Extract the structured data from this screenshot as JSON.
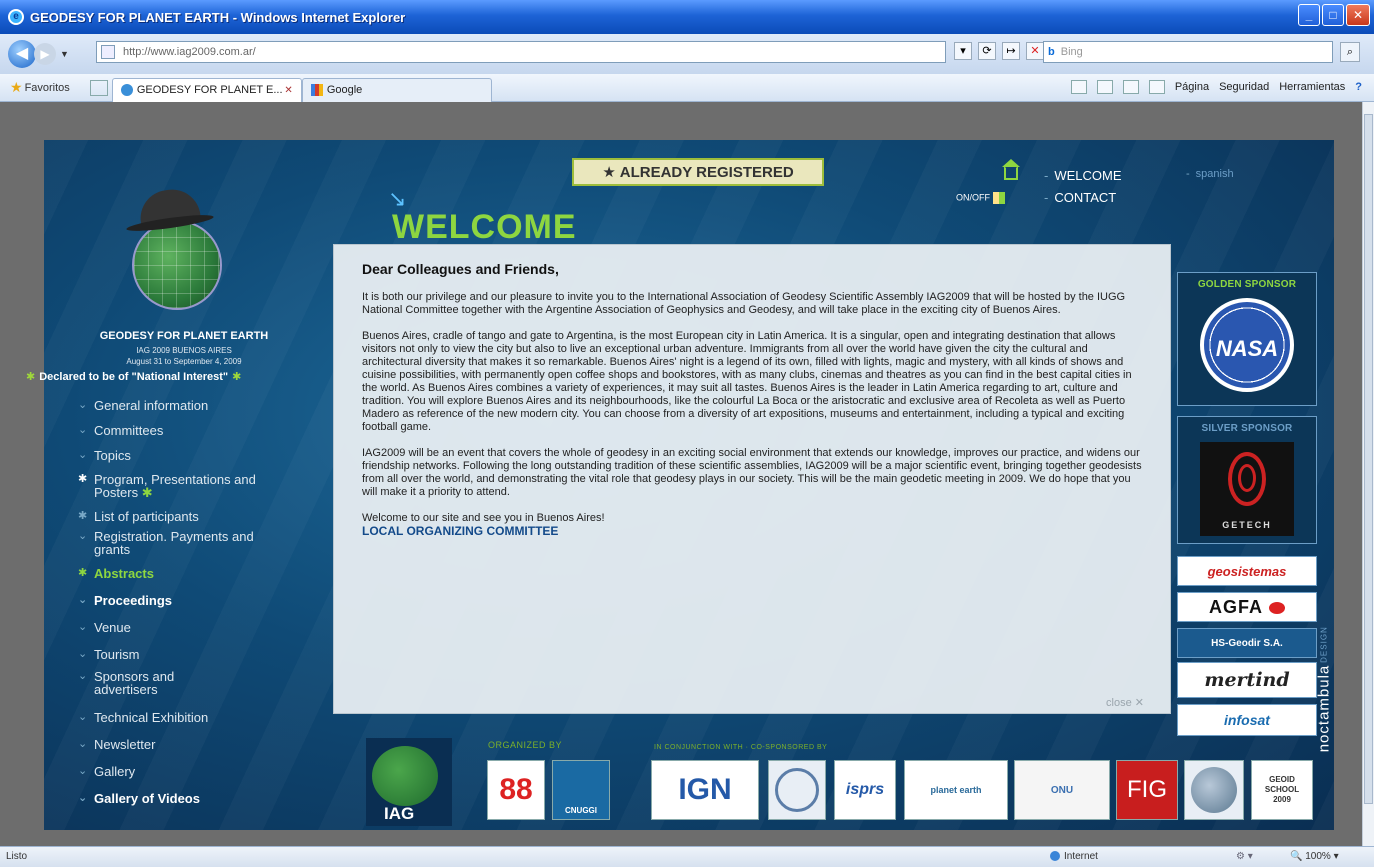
{
  "window": {
    "title": "GEODESY FOR PLANET EARTH - Windows Internet Explorer"
  },
  "address": {
    "url": "http://www.iag2009.com.ar/",
    "search_placeholder": "Bing"
  },
  "favorites": {
    "label": "Favoritos",
    "tabs": [
      {
        "label": "GEODESY FOR PLANET E...",
        "active": true
      },
      {
        "label": "Google",
        "active": false
      }
    ]
  },
  "commands": {
    "page": "Página",
    "security": "Seguridad",
    "tools": "Herramientas"
  },
  "site": {
    "already_registered": "ALREADY REGISTERED",
    "welcome_heading": "WELCOME",
    "top_nav": {
      "welcome": "WELCOME",
      "contact": "CONTACT",
      "onoff": "ON/OFF",
      "language": "spanish"
    },
    "org": {
      "title": "GEODESY FOR PLANET EARTH",
      "subtitle": "IAG 2009 BUENOS AIRES",
      "dates": "August 31 to September 4, 2009",
      "declared": "Declared to be of \"National Interest\""
    },
    "nav": [
      {
        "label": "General information",
        "style": "normal"
      },
      {
        "label": "Committees",
        "style": "normal"
      },
      {
        "label": "Topics",
        "style": "normal"
      },
      {
        "label": "Program, Presentations and Posters",
        "style": "star"
      },
      {
        "label": "List of participants",
        "style": "normal"
      },
      {
        "label": "Registration. Payments and grants",
        "style": "normal"
      },
      {
        "label": "Abstracts",
        "style": "highlight"
      },
      {
        "label": "Proceedings",
        "style": "bold"
      },
      {
        "label": "Venue",
        "style": "normal"
      },
      {
        "label": "Tourism",
        "style": "normal"
      },
      {
        "label": "Sponsors and advertisers",
        "style": "normal"
      },
      {
        "label": "Technical Exhibition",
        "style": "normal"
      },
      {
        "label": "Newsletter",
        "style": "normal"
      },
      {
        "label": "Gallery",
        "style": "normal"
      },
      {
        "label": "Gallery of Videos",
        "style": "bold"
      }
    ],
    "popup": {
      "greeting": "Dear Colleagues and Friends,",
      "p1": "It is both our privilege and our pleasure to invite you to the International Association of Geodesy Scientific Assembly IAG2009 that will be hosted by the IUGG National Committee together with the Argentine Association of Geophysics and Geodesy, and will take place in the exciting city of Buenos Aires.",
      "p2": "Buenos Aires, cradle of tango and gate to Argentina, is the most European city in Latin America. It is a singular, open and integrating destination that allows visitors not only to view the city but also to live an exceptional urban adventure. Immigrants from all over the world have given the city the cultural and architectural diversity that makes it so remarkable. Buenos Aires' night is a legend of its own, filled with lights, magic and mystery, with all kinds of shows and cuisine possibilities, with permanently open coffee shops and bookstores, with as many clubs, cinemas and theatres as you can find in the best capital cities in the world. As Buenos Aires combines a variety of experiences, it may suit all tastes. Buenos Aires is the leader in Latin America regarding to art, culture and tradition. You will explore Buenos Aires and its neighbourhoods, like the colourful La Boca or the aristocratic and exclusive area of Recoleta as well as Puerto Madero as reference of the new modern city. You can choose from a diversity of art expositions, museums and entertainment, including a typical and exciting football game.",
      "p3": "IAG2009 will be an event that covers the whole of geodesy in an exciting social environment that extends our knowledge, improves our practice, and widens our friendship networks. Following the long outstanding tradition of these scientific assemblies, IAG2009 will be a major scientific event, bringing together geodesists from all over the world, and demonstrating the vital role that geodesy plays in our society. This will be the main geodetic meeting in 2009. We do hope that you will make it a priority to attend.",
      "p4": "Welcome to our site and see you in Buenos Aires!",
      "committee": "LOCAL ORGANIZING COMMITTEE",
      "close": "close"
    },
    "sponsors": {
      "golden": "GOLDEN SPONSOR",
      "silver": "SILVER SPONSOR",
      "nasa": "NASA",
      "getech": "GETECH",
      "small": [
        "geosistemas",
        "AGFA",
        "HS-Geodir S.A.",
        "mertind",
        "infosat"
      ]
    },
    "bottom": {
      "iag": "IAG",
      "organized_by": "ORGANIZED BY",
      "cooperation": "IN CONJUNCTION WITH · CO-SPONSORED BY",
      "b88": "88",
      "cnuggi": "CNUGGI",
      "ign": "IGN",
      "isprs": "isprs",
      "planet": "planet earth",
      "onu": "ONU",
      "fig": "FIG",
      "geoid": [
        "GEOID",
        "SCHOOL",
        "2009"
      ]
    },
    "brand": "noctambula",
    "brand_sub": "DESIGN"
  },
  "status": {
    "left": "Listo",
    "zone": "Internet",
    "zoom": "100%"
  }
}
